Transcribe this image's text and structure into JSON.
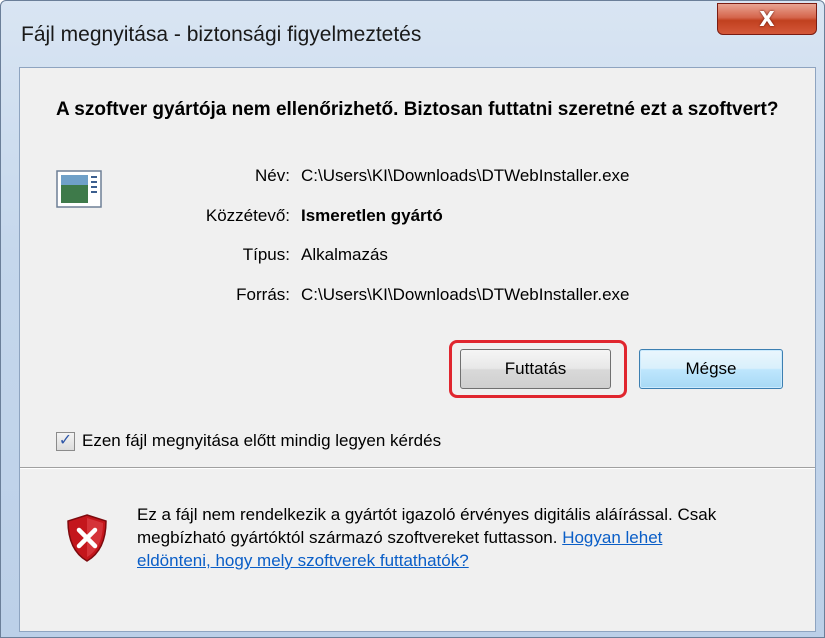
{
  "window": {
    "title": "Fájl megnyitása - biztonsági figyelmeztetés",
    "close_label": "X"
  },
  "heading": "A szoftver gyártója nem ellenőrizhető. Biztosan futtatni szeretné ezt a szoftvert?",
  "properties": [
    {
      "label": "Név:",
      "value": "C:\\Users\\KI\\Downloads\\DTWebInstaller.exe",
      "bold": false
    },
    {
      "label": "Közzétevő:",
      "value": "Ismeretlen gyártó",
      "bold": true
    },
    {
      "label": "Típus:",
      "value": "Alkalmazás",
      "bold": false
    },
    {
      "label": "Forrás:",
      "value": "C:\\Users\\KI\\Downloads\\DTWebInstaller.exe",
      "bold": false
    }
  ],
  "buttons": {
    "run": "Futtatás",
    "cancel": "Mégse"
  },
  "checkbox": {
    "label": "Ezen fájl megnyitása előtt mindig legyen kérdés",
    "checked": true
  },
  "warning": {
    "text": "Ez a fájl nem rendelkezik a gyártót igazoló érvényes digitális aláírással. Csak megbízható gyártóktól származó szoftvereket futtasson. ",
    "link": "Hogyan lehet eldönteni, hogy mely szoftverek futtathatók?"
  },
  "colors": {
    "highlight": "#e0262f",
    "link": "#0a5ec7",
    "shield": "#c4161c"
  }
}
